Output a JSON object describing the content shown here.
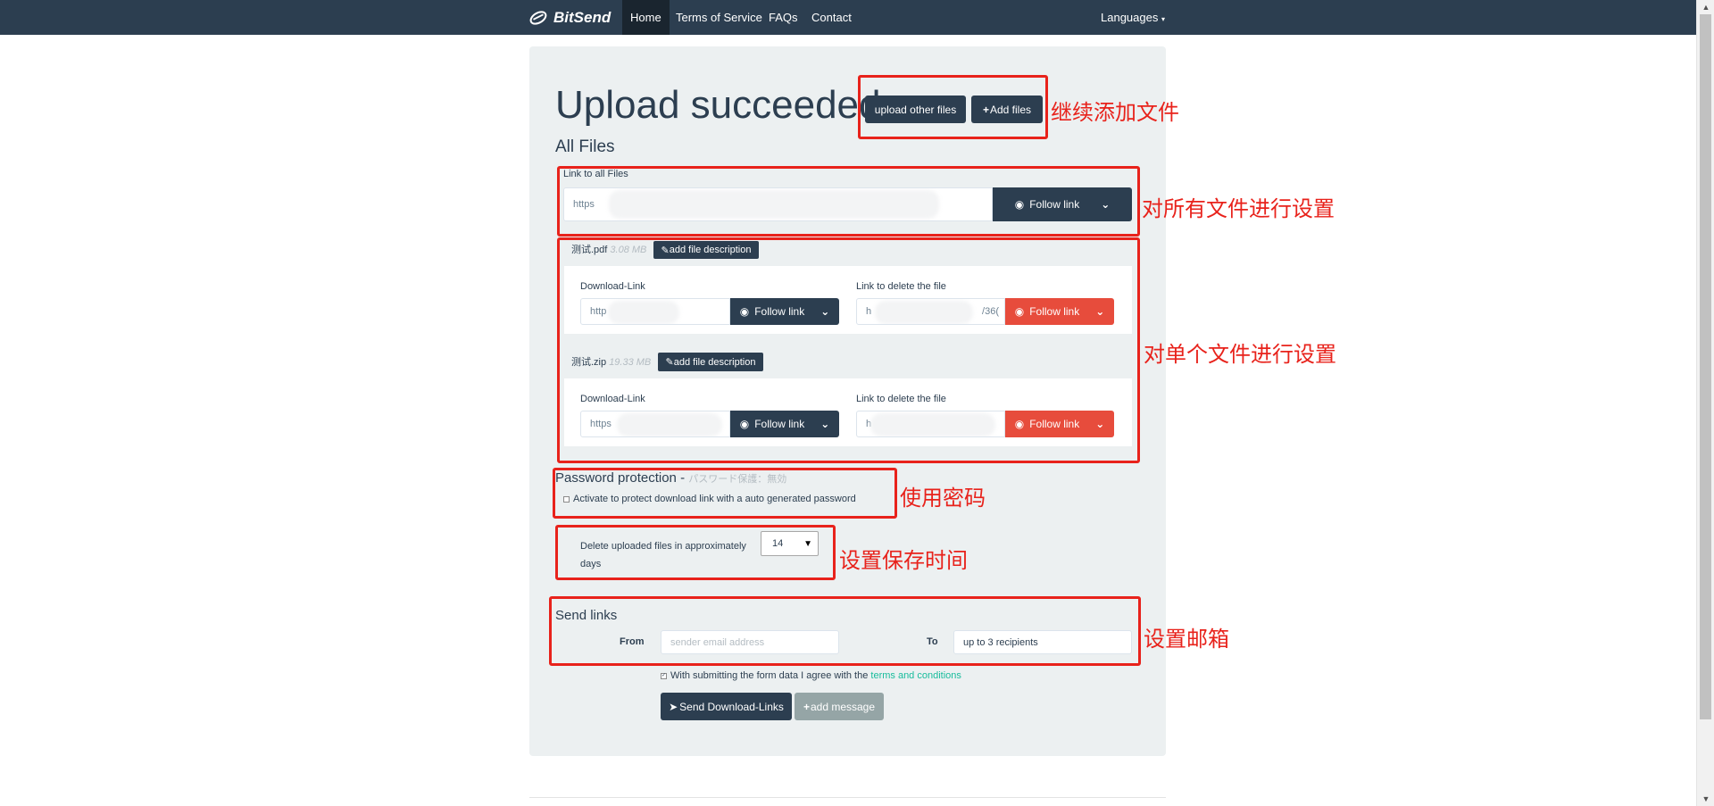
{
  "navbar": {
    "brand": "BitSend",
    "items": [
      {
        "label": "Home",
        "active": true
      },
      {
        "label": "Terms of Service",
        "active": false
      },
      {
        "label": "FAQs",
        "active": false
      },
      {
        "label": "Contact",
        "active": false
      }
    ],
    "languages": "Languages",
    "bg_color": "#2c3e50"
  },
  "heading": "Upload succeeded",
  "top_buttons": {
    "upload_other": "upload other files",
    "add_files": "Add files"
  },
  "all_files": {
    "title": "All Files",
    "link_label": "Link to all Files",
    "link_value": "https",
    "follow": "Follow link"
  },
  "files": [
    {
      "name": "测试.pdf",
      "size": "3.08 MB",
      "add_desc": "add file description",
      "download_label": "Download-Link",
      "download_value": "http",
      "delete_label": "Link to delete the file",
      "delete_value": "h",
      "delete_tail": "/36(",
      "follow": "Follow link"
    },
    {
      "name": "测试.zip",
      "size": "19.33 MB",
      "add_desc": "add file description",
      "download_label": "Download-Link",
      "download_value": "https",
      "delete_label": "Link to delete the file",
      "delete_value": "h",
      "follow": "Follow link"
    }
  ],
  "password": {
    "title": "Password protection -",
    "subtitle": "パスワード保護：無効",
    "checkbox_label": "Activate to protect download link with a auto generated password"
  },
  "delete_days": {
    "label_before": "Delete uploaded files in approximately",
    "label_after": "days",
    "value": "14"
  },
  "send_links": {
    "title": "Send links",
    "from_label": "From",
    "from_placeholder": "sender email address",
    "to_label": "To",
    "to_placeholder": "up to 3 recipients",
    "agree_text": "With submitting the form data I agree with the",
    "agree_link": "terms and conditions",
    "send_button": "Send Download-Links",
    "add_message": "add message"
  },
  "annotations": {
    "continue_add": "继续添加文件",
    "all_settings": "对所有文件进行设置",
    "single_settings": "对单个文件进行设置",
    "use_password": "使用密码",
    "save_time": "设置保存时间",
    "email": "设置邮箱"
  },
  "colors": {
    "primary": "#2c3e50",
    "danger": "#e74c3c",
    "success": "#18bc9c",
    "annotation": "#e8221b"
  }
}
